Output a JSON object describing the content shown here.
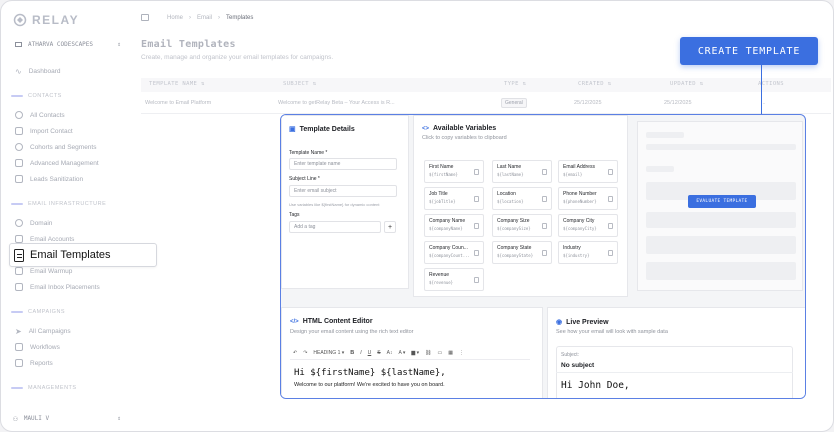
{
  "brand": {
    "name": "RELAY"
  },
  "workspace": {
    "name": "ATHARVA CODESCAPES"
  },
  "nav": {
    "dashboard": "Dashboard",
    "contacts_section": "CONTACTS",
    "contacts_items": [
      "All Contacts",
      "Import Contact",
      "Cohorts and Segments",
      "Advanced Management",
      "Leads Sanitization"
    ],
    "infra_section": "EMAIL INFRASTRUCTURE",
    "infra_items": [
      "Domain",
      "Email Accounts"
    ],
    "active_item": "Email Templates",
    "infra_items_after": [
      "Email Warmup",
      "Email Inbox Placements"
    ],
    "campaigns_section": "CAMPAIGNS",
    "campaign_items": [
      "All Campaigns",
      "Workflows",
      "Reports"
    ],
    "management_section": "MANAGEMENTS"
  },
  "user": {
    "name": "MAULI V"
  },
  "breadcrumb": [
    "Home",
    "Email",
    "Templates"
  ],
  "page": {
    "title": "Email Templates",
    "subtitle": "Create, manage and organize your email templates for campaigns."
  },
  "table": {
    "headers": [
      "TEMPLATE NAME",
      "SUBJECT",
      "TYPE",
      "CREATED",
      "UPDATED",
      "ACTIONS"
    ],
    "rows": [
      {
        "name": "Welcome to Email Platform",
        "subject": "Welcome to getRelay Beta – Your Access is R...",
        "type": "General",
        "created": "25/12/2025",
        "updated": "25/12/2025",
        "actions": "..."
      }
    ]
  },
  "cta": {
    "label": "CREATE TEMPLATE"
  },
  "details": {
    "title": "Template Details",
    "name_label": "Template Name *",
    "name_placeholder": "Enter template name",
    "subject_label": "Subject Line *",
    "subject_placeholder": "Enter email subject",
    "hint": "Use variables like ${firstName} for dynamic content",
    "tags_label": "Tags",
    "tag_placeholder": "Add a tag",
    "add": "+"
  },
  "variables": {
    "title": "Available Variables",
    "subtitle": "Click to copy variables to clipboard",
    "items": [
      {
        "name": "First Name",
        "token": "${firstName}"
      },
      {
        "name": "Last Name",
        "token": "${lastName}"
      },
      {
        "name": "Email Address",
        "token": "${email}"
      },
      {
        "name": "Job Title",
        "token": "${jobTitle}"
      },
      {
        "name": "Location",
        "token": "${location}"
      },
      {
        "name": "Phone Number",
        "token": "${phoneNumber}"
      },
      {
        "name": "Company Name",
        "token": "${companyName}"
      },
      {
        "name": "Company Size",
        "token": "${companySize}"
      },
      {
        "name": "Company City",
        "token": "${companyCity}"
      },
      {
        "name": "Company Coun...",
        "token": "${companyCount..."
      },
      {
        "name": "Company State",
        "token": "${companyState}"
      },
      {
        "name": "Industry",
        "token": "${industry}"
      },
      {
        "name": "Revenue",
        "token": "${revenue}"
      }
    ]
  },
  "evaluate": {
    "label": "EVALUATE TEMPLATE"
  },
  "editor": {
    "title": "HTML Content Editor",
    "subtitle": "Design your email content using the rich text editor",
    "heading_select": "HEADING 1",
    "line1": "Hi ${firstName} ${lastName},",
    "line2": "Welcome to our platform! We're excited to have you on board."
  },
  "preview": {
    "title": "Live Preview",
    "subtitle": "See how your email will look with sample data",
    "subject_label": "Subject:",
    "subject_value": "No subject",
    "greeting": "Hi John Doe,"
  },
  "colors": {
    "accent": "#3b6fe0"
  }
}
